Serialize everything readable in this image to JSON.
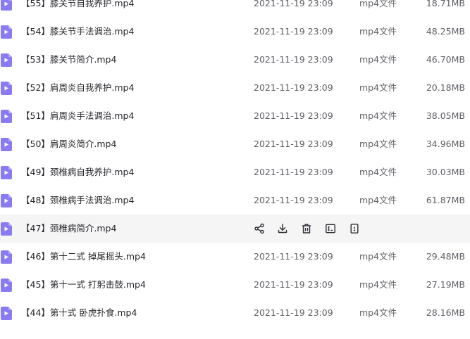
{
  "columns": {
    "date_color": "#5f6066",
    "icon_color": "#8a7bf5"
  },
  "files": [
    {
      "name": "【55】膝关节自我养护.mp4",
      "date": "2021-11-19 23:09",
      "type": "mp4文件",
      "size": "18.71MB"
    },
    {
      "name": "【54】膝关节手法调治.mp4",
      "date": "2021-11-19 23:09",
      "type": "mp4文件",
      "size": "48.25MB"
    },
    {
      "name": "【53】膝关节简介.mp4",
      "date": "2021-11-19 23:09",
      "type": "mp4文件",
      "size": "46.70MB"
    },
    {
      "name": "【52】肩周炎自我养护.mp4",
      "date": "2021-11-19 23:09",
      "type": "mp4文件",
      "size": "20.18MB"
    },
    {
      "name": "【51】肩周炎手法调治.mp4",
      "date": "2021-11-19 23:09",
      "type": "mp4文件",
      "size": "38.05MB"
    },
    {
      "name": "【50】肩周炎简介.mp4",
      "date": "2021-11-19 23:09",
      "type": "mp4文件",
      "size": "34.96MB"
    },
    {
      "name": "【49】颈椎病自我养护.mp4",
      "date": "2021-11-19 23:09",
      "type": "mp4文件",
      "size": "30.03MB"
    },
    {
      "name": "【48】颈椎病手法调治.mp4",
      "date": "2021-11-19 23:09",
      "type": "mp4文件",
      "size": "61.87MB"
    },
    {
      "name": "【47】颈椎病简介.mp4",
      "date": "",
      "type": "",
      "size": "",
      "hovered": true
    },
    {
      "name": "【46】第十二式 掉尾摇头.mp4",
      "date": "2021-11-19 23:09",
      "type": "mp4文件",
      "size": "29.48MB"
    },
    {
      "name": "【45】第十一式 打躬击鼓.mp4",
      "date": "2021-11-19 23:09",
      "type": "mp4文件",
      "size": "27.19MB"
    },
    {
      "name": "【44】第十式 卧虎扑食.mp4",
      "date": "2021-11-19 23:09",
      "type": "mp4文件",
      "size": "28.16MB"
    }
  ],
  "row_actions": [
    {
      "icon": "share-icon"
    },
    {
      "icon": "download-icon"
    },
    {
      "icon": "delete-icon"
    },
    {
      "icon": "rename-icon"
    },
    {
      "icon": "more-icon"
    }
  ]
}
